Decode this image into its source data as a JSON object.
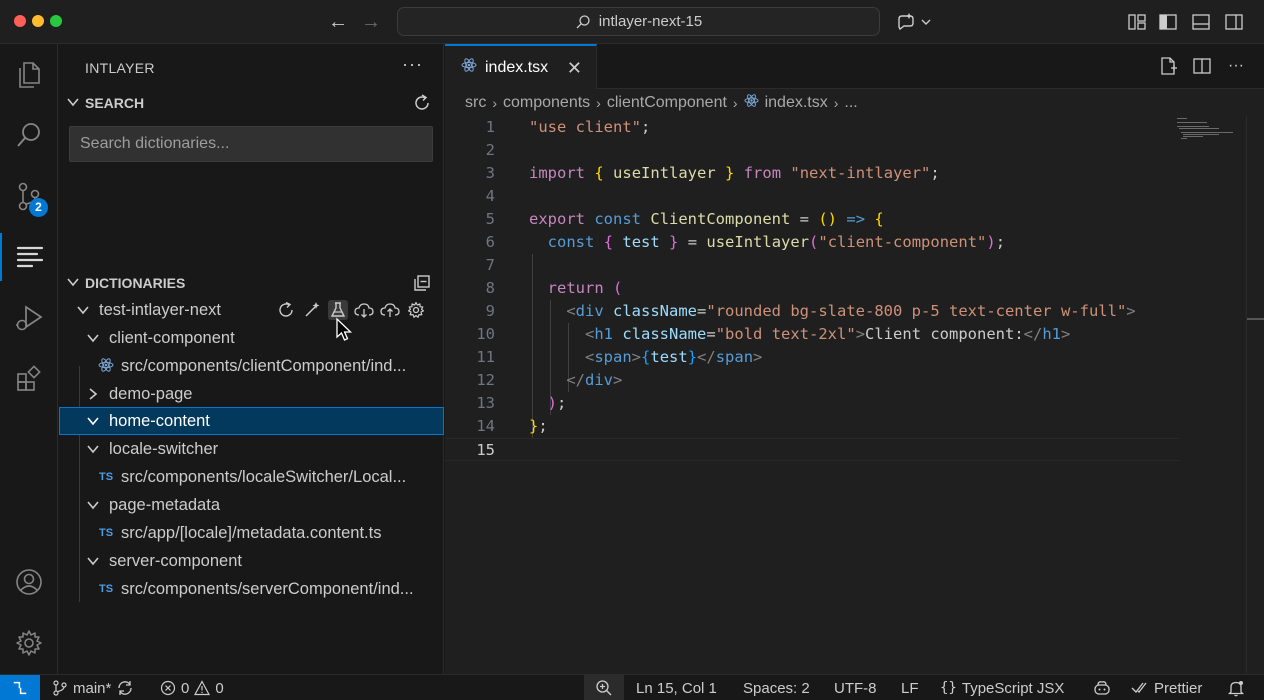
{
  "titlebar": {
    "command_center": "intlayer-next-15"
  },
  "activitybar": {
    "source_control_badge": "2"
  },
  "sidebar": {
    "title": "INTLAYER",
    "search_section": {
      "title": "SEARCH",
      "placeholder": "Search dictionaries..."
    },
    "dictionaries_section": {
      "title": "DICTIONARIES",
      "items": [
        {
          "label": "test-intlayer-next",
          "level": 0,
          "expanded": true,
          "icon": "chevron-down-icon"
        },
        {
          "label": "client-component",
          "level": 1,
          "expanded": true,
          "icon": "chevron-down-icon"
        },
        {
          "label": "src/components/clientComponent/ind...",
          "level": 2,
          "file_type": "react"
        },
        {
          "label": "demo-page",
          "level": 1,
          "expanded": false,
          "icon": "chevron-right-icon"
        },
        {
          "label": "home-content",
          "level": 1,
          "expanded": true,
          "selected": true,
          "icon": "chevron-down-icon"
        },
        {
          "label": "locale-switcher",
          "level": 1,
          "expanded": true,
          "icon": "chevron-down-icon"
        },
        {
          "label": "src/components/localeSwitcher/Local...",
          "level": 2,
          "file_type": "TS"
        },
        {
          "label": "page-metadata",
          "level": 1,
          "expanded": true,
          "icon": "chevron-down-icon"
        },
        {
          "label": "src/app/[locale]/metadata.content.ts",
          "level": 2,
          "file_type": "TS"
        },
        {
          "label": "server-component",
          "level": 1,
          "expanded": true,
          "icon": "chevron-down-icon"
        },
        {
          "label": "src/components/serverComponent/ind...",
          "level": 2,
          "file_type": "TS"
        }
      ]
    }
  },
  "editor": {
    "tab": {
      "label": "index.tsx"
    },
    "breadcrumb": [
      "src",
      "components",
      "clientComponent",
      "index.tsx",
      "..."
    ],
    "active_line": 15
  },
  "statusbar": {
    "branch": "main*",
    "errors": "0",
    "warnings": "0",
    "position": "Ln 15, Col 1",
    "spaces": "Spaces: 2",
    "encoding": "UTF-8",
    "eol": "LF",
    "language": "TypeScript JSX",
    "formatter": "Prettier"
  },
  "colors": {
    "accent": "#0078d4",
    "background": "#1f1f1f",
    "sidebar": "#181818",
    "selection": "#04395e"
  }
}
